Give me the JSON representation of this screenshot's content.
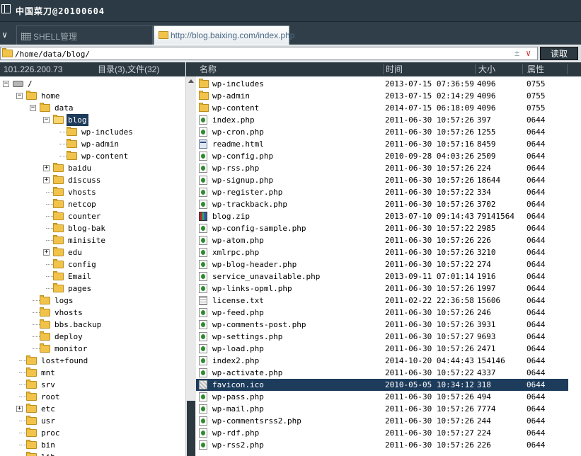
{
  "window": {
    "title": "中国菜刀@20100604"
  },
  "tabs": [
    {
      "label": "SHELL管理",
      "icon": "grid-icon",
      "active": false
    },
    {
      "label": "http://blog.baixing.com/index.php",
      "icon": "folder-icon",
      "active": true
    }
  ],
  "address": {
    "path": "/home/data/blog/",
    "plus": "±",
    "dropdown": "∨",
    "read_button": "读取"
  },
  "left_header": {
    "ip": "101.226.200.73",
    "summary": "目录(3),文件(32)"
  },
  "columns": {
    "name": "名称",
    "time": "时间",
    "size": "大小",
    "attr": "属性"
  },
  "tree": [
    {
      "label": "/",
      "icon": "drive",
      "depth": 0,
      "expander": "-"
    },
    {
      "label": "home",
      "icon": "folder",
      "depth": 1,
      "expander": "-"
    },
    {
      "label": "data",
      "icon": "folder",
      "depth": 2,
      "expander": "-"
    },
    {
      "label": "blog",
      "icon": "folder-open",
      "depth": 3,
      "expander": "-",
      "selected": true
    },
    {
      "label": "wp-includes",
      "icon": "folder",
      "depth": 4,
      "expander": ""
    },
    {
      "label": "wp-admin",
      "icon": "folder",
      "depth": 4,
      "expander": ""
    },
    {
      "label": "wp-content",
      "icon": "folder",
      "depth": 4,
      "expander": ""
    },
    {
      "label": "baidu",
      "icon": "folder",
      "depth": 3,
      "expander": "+"
    },
    {
      "label": "discuss",
      "icon": "folder",
      "depth": 3,
      "expander": "+"
    },
    {
      "label": "vhosts",
      "icon": "folder",
      "depth": 3,
      "expander": ""
    },
    {
      "label": "netcop",
      "icon": "folder",
      "depth": 3,
      "expander": ""
    },
    {
      "label": "counter",
      "icon": "folder",
      "depth": 3,
      "expander": ""
    },
    {
      "label": "blog-bak",
      "icon": "folder",
      "depth": 3,
      "expander": ""
    },
    {
      "label": "minisite",
      "icon": "folder",
      "depth": 3,
      "expander": ""
    },
    {
      "label": "edu",
      "icon": "folder",
      "depth": 3,
      "expander": "+"
    },
    {
      "label": "config",
      "icon": "folder",
      "depth": 3,
      "expander": ""
    },
    {
      "label": "Email",
      "icon": "folder",
      "depth": 3,
      "expander": ""
    },
    {
      "label": "pages",
      "icon": "folder",
      "depth": 3,
      "expander": ""
    },
    {
      "label": "logs",
      "icon": "folder",
      "depth": 2,
      "expander": ""
    },
    {
      "label": "vhosts",
      "icon": "folder",
      "depth": 2,
      "expander": ""
    },
    {
      "label": "bbs.backup",
      "icon": "folder",
      "depth": 2,
      "expander": ""
    },
    {
      "label": "deploy",
      "icon": "folder",
      "depth": 2,
      "expander": ""
    },
    {
      "label": "monitor",
      "icon": "folder",
      "depth": 2,
      "expander": ""
    },
    {
      "label": "lost+found",
      "icon": "folder",
      "depth": 1,
      "expander": ""
    },
    {
      "label": "mnt",
      "icon": "folder",
      "depth": 1,
      "expander": ""
    },
    {
      "label": "srv",
      "icon": "folder",
      "depth": 1,
      "expander": ""
    },
    {
      "label": "root",
      "icon": "folder",
      "depth": 1,
      "expander": ""
    },
    {
      "label": "etc",
      "icon": "folder",
      "depth": 1,
      "expander": "+"
    },
    {
      "label": "usr",
      "icon": "folder",
      "depth": 1,
      "expander": ""
    },
    {
      "label": "proc",
      "icon": "folder",
      "depth": 1,
      "expander": ""
    },
    {
      "label": "bin",
      "icon": "folder",
      "depth": 1,
      "expander": ""
    },
    {
      "label": "lib",
      "icon": "folder",
      "depth": 1,
      "expander": ""
    }
  ],
  "files": [
    {
      "name": "wp-includes",
      "time": "2013-07-15 07:36:59",
      "size": "4096",
      "attr": "0755",
      "icon": "dir"
    },
    {
      "name": "wp-admin",
      "time": "2013-07-15 02:14:29",
      "size": "4096",
      "attr": "0755",
      "icon": "dir"
    },
    {
      "name": "wp-content",
      "time": "2014-07-15 06:18:09",
      "size": "4096",
      "attr": "0755",
      "icon": "dir"
    },
    {
      "name": "index.php",
      "time": "2011-06-30 10:57:26",
      "size": "397",
      "attr": "0644",
      "icon": "php"
    },
    {
      "name": "wp-cron.php",
      "time": "2011-06-30 10:57:26",
      "size": "1255",
      "attr": "0644",
      "icon": "php"
    },
    {
      "name": "readme.html",
      "time": "2011-06-30 10:57:16",
      "size": "8459",
      "attr": "0644",
      "icon": "html"
    },
    {
      "name": "wp-config.php",
      "time": "2010-09-28 04:03:26",
      "size": "2509",
      "attr": "0644",
      "icon": "php"
    },
    {
      "name": "wp-rss.php",
      "time": "2011-06-30 10:57:26",
      "size": "224",
      "attr": "0644",
      "icon": "php"
    },
    {
      "name": "wp-signup.php",
      "time": "2011-06-30 10:57:26",
      "size": "18644",
      "attr": "0644",
      "icon": "php"
    },
    {
      "name": "wp-register.php",
      "time": "2011-06-30 10:57:22",
      "size": "334",
      "attr": "0644",
      "icon": "php"
    },
    {
      "name": "wp-trackback.php",
      "time": "2011-06-30 10:57:26",
      "size": "3702",
      "attr": "0644",
      "icon": "php"
    },
    {
      "name": "blog.zip",
      "time": "2013-07-10 09:14:43",
      "size": "79141564",
      "attr": "0644",
      "icon": "zip"
    },
    {
      "name": "wp-config-sample.php",
      "time": "2011-06-30 10:57:22",
      "size": "2985",
      "attr": "0644",
      "icon": "php"
    },
    {
      "name": "wp-atom.php",
      "time": "2011-06-30 10:57:26",
      "size": "226",
      "attr": "0644",
      "icon": "php"
    },
    {
      "name": "xmlrpc.php",
      "time": "2011-06-30 10:57:26",
      "size": "3210",
      "attr": "0644",
      "icon": "php"
    },
    {
      "name": "wp-blog-header.php",
      "time": "2011-06-30 10:57:22",
      "size": "274",
      "attr": "0644",
      "icon": "php"
    },
    {
      "name": "service_unavailable.php",
      "time": "2013-09-11 07:01:14",
      "size": "1916",
      "attr": "0644",
      "icon": "php"
    },
    {
      "name": "wp-links-opml.php",
      "time": "2011-06-30 10:57:26",
      "size": "1997",
      "attr": "0644",
      "icon": "php"
    },
    {
      "name": "license.txt",
      "time": "2011-02-22 22:36:58",
      "size": "15606",
      "attr": "0644",
      "icon": "txt"
    },
    {
      "name": "wp-feed.php",
      "time": "2011-06-30 10:57:26",
      "size": "246",
      "attr": "0644",
      "icon": "php"
    },
    {
      "name": "wp-comments-post.php",
      "time": "2011-06-30 10:57:26",
      "size": "3931",
      "attr": "0644",
      "icon": "php"
    },
    {
      "name": "wp-settings.php",
      "time": "2011-06-30 10:57:27",
      "size": "9693",
      "attr": "0644",
      "icon": "php"
    },
    {
      "name": "wp-load.php",
      "time": "2011-06-30 10:57:26",
      "size": "2471",
      "attr": "0644",
      "icon": "php"
    },
    {
      "name": "index2.php",
      "time": "2014-10-20 04:44:43",
      "size": "154146",
      "attr": "0644",
      "icon": "php"
    },
    {
      "name": "wp-activate.php",
      "time": "2011-06-30 10:57:22",
      "size": "4337",
      "attr": "0644",
      "icon": "php"
    },
    {
      "name": "favicon.ico",
      "time": "2010-05-05 10:34:12",
      "size": "318",
      "attr": "0644",
      "icon": "ico",
      "selected": true
    },
    {
      "name": "wp-pass.php",
      "time": "2011-06-30 10:57:26",
      "size": "494",
      "attr": "0644",
      "icon": "php"
    },
    {
      "name": "wp-mail.php",
      "time": "2011-06-30 10:57:26",
      "size": "7774",
      "attr": "0644",
      "icon": "php"
    },
    {
      "name": "wp-commentsrss2.php",
      "time": "2011-06-30 10:57:26",
      "size": "244",
      "attr": "0644",
      "icon": "php"
    },
    {
      "name": "wp-rdf.php",
      "time": "2011-06-30 10:57:27",
      "size": "224",
      "attr": "0644",
      "icon": "php"
    },
    {
      "name": "wp-rss2.php",
      "time": "2011-06-30 10:57:26",
      "size": "226",
      "attr": "0644",
      "icon": "php"
    }
  ]
}
